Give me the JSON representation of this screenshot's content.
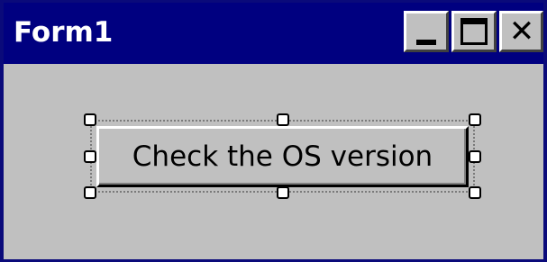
{
  "window": {
    "title": "Form1",
    "colors": {
      "titlebar": "#000080",
      "title_text": "#ffffff",
      "face": "#c0c0c0"
    }
  },
  "caption_buttons": {
    "minimize_icon": "minimize-icon",
    "maximize_icon": "maximize-icon",
    "close_icon": "close-icon",
    "close_glyph": "✕"
  },
  "form": {
    "button_label": "Check the OS version",
    "selected": true
  }
}
